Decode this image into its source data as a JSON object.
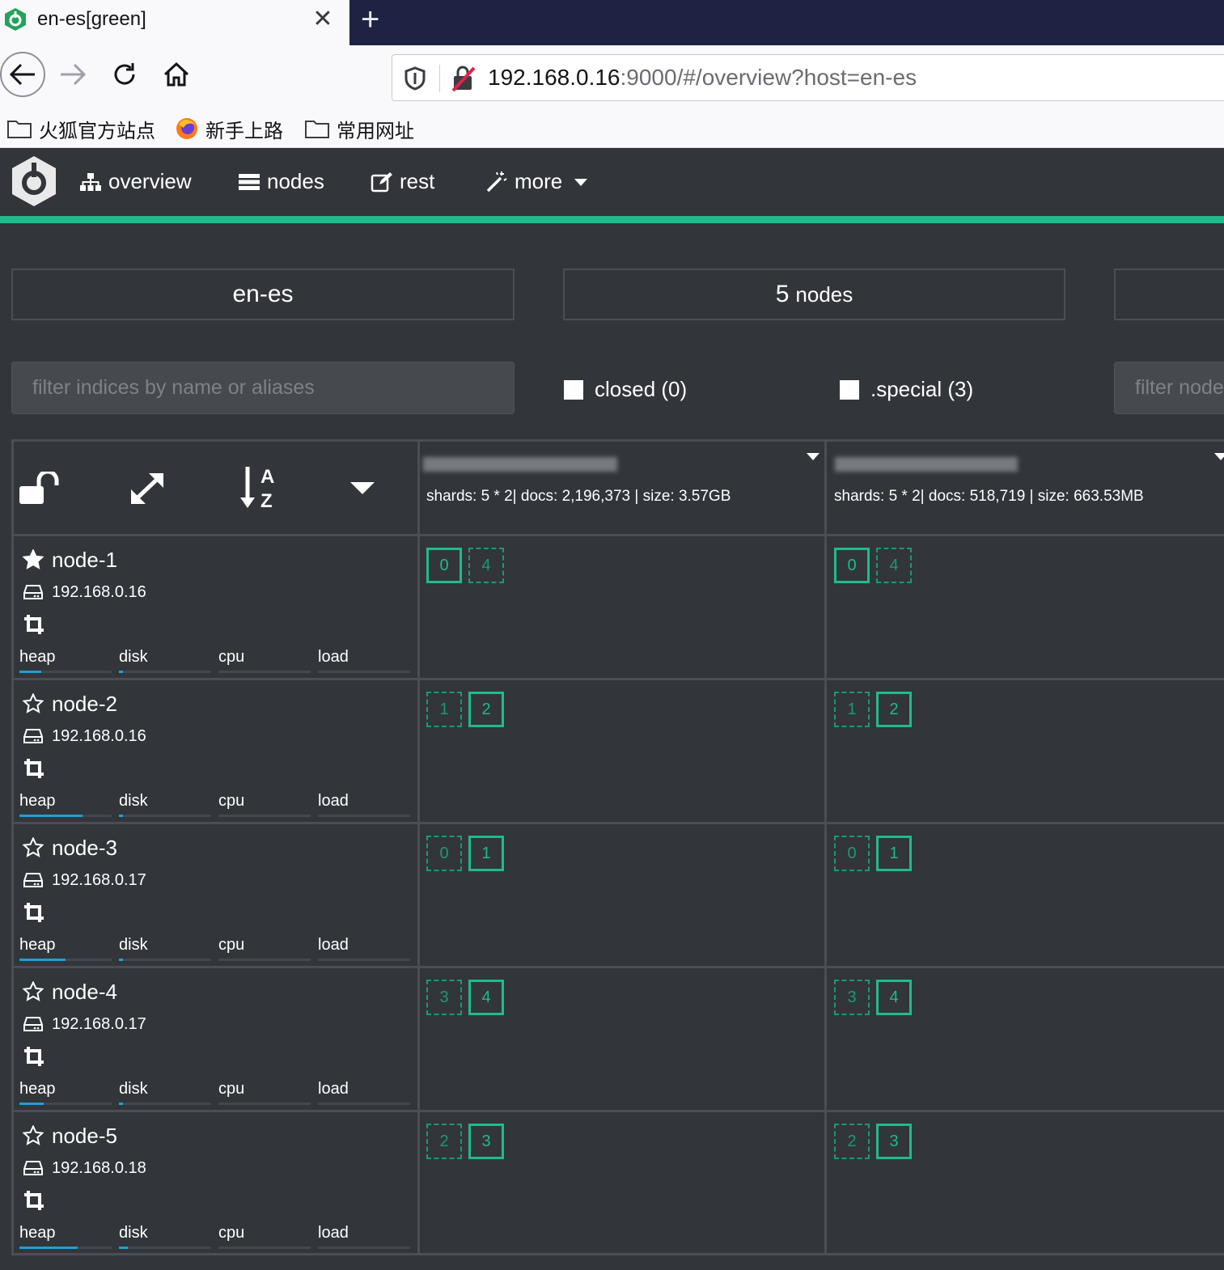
{
  "browser": {
    "tab_title": "en-es[green]",
    "url_host": "192.168.0.16",
    "url_rest": ":9000/#/overview?host=en-es",
    "bookmarks": [
      {
        "label": "火狐官方站点",
        "icon": "folder-icon"
      },
      {
        "label": "新手上路",
        "icon": "firefox-icon"
      },
      {
        "label": "常用网址",
        "icon": "folder-icon"
      }
    ]
  },
  "app": {
    "menu": [
      {
        "label": "overview",
        "icon": "sitemap-icon"
      },
      {
        "label": "nodes",
        "icon": "server-icon"
      },
      {
        "label": "rest",
        "icon": "edit-icon"
      },
      {
        "label": "more",
        "icon": "magic-wand-icon"
      }
    ],
    "accent_color": "#1fbb8c"
  },
  "overview": {
    "cluster_name": "en-es",
    "nodes_count": "5",
    "nodes_label": "nodes",
    "filter_indices_placeholder": "filter indices by name or aliases",
    "closed_label": "closed (0)",
    "special_label": ".special (3)",
    "filter_nodes_placeholder": "filter nodes"
  },
  "indices": [
    {
      "name": "",
      "stats": "shards: 5 * 2| docs: 2,196,373 | size: 3.57GB"
    },
    {
      "name": "",
      "stats": "shards: 5 * 2| docs: 518,719 | size: 663.53MB"
    }
  ],
  "metric_labels": [
    "heap",
    "disk",
    "cpu",
    "load"
  ],
  "nodes": [
    {
      "name": "node-1",
      "ip": "192.168.0.16",
      "master": true,
      "heap": 0.24,
      "disk": 0.04,
      "cpu": 0,
      "load": 0,
      "shards": [
        [
          {
            "n": "0",
            "p": true
          },
          {
            "n": "4",
            "p": false
          }
        ],
        [
          {
            "n": "0",
            "p": true
          },
          {
            "n": "4",
            "p": false
          }
        ]
      ]
    },
    {
      "name": "node-2",
      "ip": "192.168.0.16",
      "master": false,
      "heap": 0.68,
      "disk": 0.04,
      "cpu": 0,
      "load": 0,
      "shards": [
        [
          {
            "n": "1",
            "p": false
          },
          {
            "n": "2",
            "p": true
          }
        ],
        [
          {
            "n": "1",
            "p": false
          },
          {
            "n": "2",
            "p": true
          }
        ]
      ]
    },
    {
      "name": "node-3",
      "ip": "192.168.0.17",
      "master": false,
      "heap": 0.5,
      "disk": 0.04,
      "cpu": 0,
      "load": 0,
      "shards": [
        [
          {
            "n": "0",
            "p": false
          },
          {
            "n": "1",
            "p": true
          }
        ],
        [
          {
            "n": "0",
            "p": false
          },
          {
            "n": "1",
            "p": true
          }
        ]
      ]
    },
    {
      "name": "node-4",
      "ip": "192.168.0.17",
      "master": false,
      "heap": 0.26,
      "disk": 0.04,
      "cpu": 0,
      "load": 0,
      "shards": [
        [
          {
            "n": "3",
            "p": false
          },
          {
            "n": "4",
            "p": true
          }
        ],
        [
          {
            "n": "3",
            "p": false
          },
          {
            "n": "4",
            "p": true
          }
        ]
      ]
    },
    {
      "name": "node-5",
      "ip": "192.168.0.18",
      "master": false,
      "heap": 0.63,
      "disk": 0.1,
      "cpu": 0,
      "load": 0,
      "shards": [
        [
          {
            "n": "2",
            "p": false
          },
          {
            "n": "3",
            "p": true
          }
        ],
        [
          {
            "n": "2",
            "p": false
          },
          {
            "n": "3",
            "p": true
          }
        ]
      ]
    }
  ]
}
